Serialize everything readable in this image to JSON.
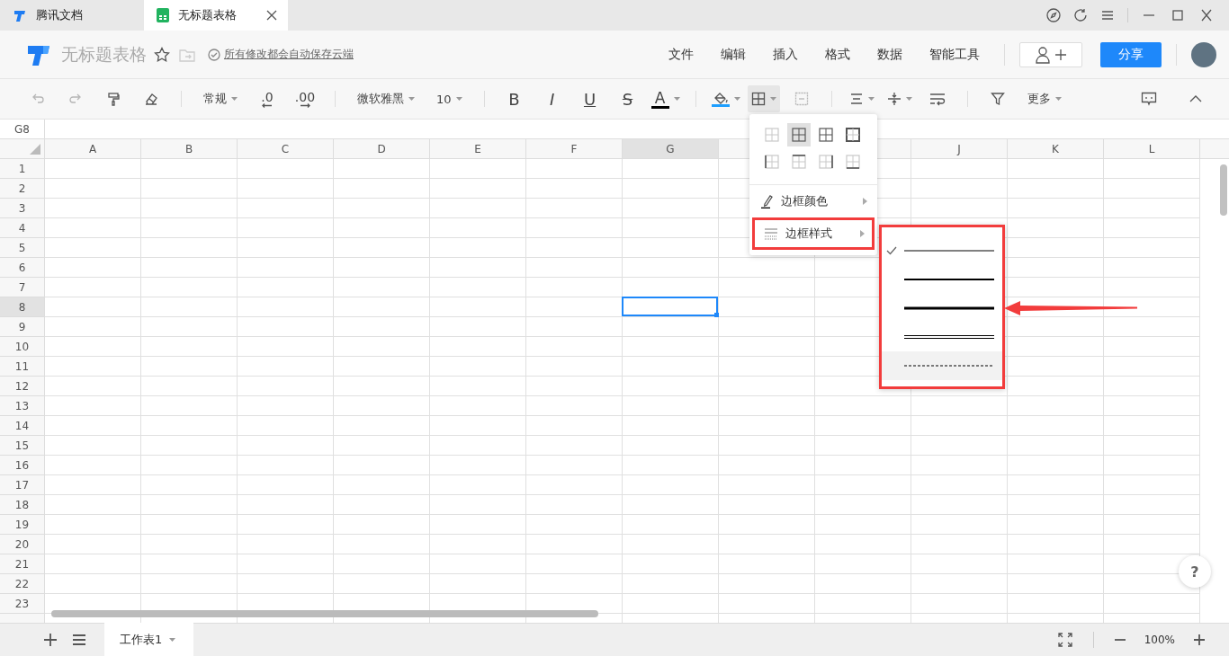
{
  "browser_tabs": [
    {
      "kind": "docs",
      "label": "腾讯文档",
      "selected": false
    },
    {
      "kind": "sheet",
      "label": "无标题表格",
      "selected": true
    }
  ],
  "header": {
    "title": "无标题表格",
    "save_status": "所有修改都会自动保存云端",
    "menu": [
      "文件",
      "编辑",
      "插入",
      "格式",
      "数据",
      "智能工具"
    ],
    "share_button": "分享"
  },
  "toolbar": {
    "groups": [
      [
        {
          "kind": "undo",
          "disabled": true,
          "open": false
        },
        {
          "kind": "redo",
          "disabled": true,
          "open": false
        },
        {
          "kind": "painter",
          "disabled": false,
          "open": false
        },
        {
          "kind": "eraser",
          "disabled": false,
          "open": false
        }
      ],
      [
        {
          "kind": "dropdown",
          "label": "常规",
          "disabled": false,
          "open": false
        },
        {
          "kind": "decimal-dec",
          "label": ".0",
          "disabled": false,
          "open": false
        },
        {
          "kind": "decimal-inc",
          "label": ".00",
          "disabled": false,
          "open": false
        }
      ],
      [
        {
          "kind": "dropdown",
          "label": "微软雅黑",
          "disabled": false,
          "open": false
        },
        {
          "kind": "dropdown",
          "label": "10",
          "disabled": false,
          "open": false
        }
      ],
      [
        {
          "kind": "bold",
          "label": "B",
          "disabled": false,
          "open": false
        },
        {
          "kind": "italic",
          "label": "I",
          "disabled": false,
          "open": false
        },
        {
          "kind": "underline",
          "label": "U",
          "disabled": false,
          "open": false
        },
        {
          "kind": "strike",
          "label": "S",
          "disabled": false,
          "open": false
        },
        {
          "kind": "font-color",
          "label": "A",
          "color": "#000000",
          "disabled": false,
          "open": false
        }
      ],
      [
        {
          "kind": "fill-color",
          "color": "#1e9fff",
          "disabled": false,
          "open": false
        },
        {
          "kind": "borders",
          "disabled": false,
          "open": true
        },
        {
          "kind": "merge",
          "disabled": true,
          "open": false
        }
      ],
      [
        {
          "kind": "align",
          "disabled": false,
          "open": false
        },
        {
          "kind": "valign",
          "disabled": false,
          "open": false
        },
        {
          "kind": "wrap",
          "disabled": false,
          "open": false
        }
      ],
      [
        {
          "kind": "filter",
          "disabled": false,
          "open": false
        },
        {
          "kind": "dropdown",
          "label": "更多",
          "disabled": false,
          "open": false
        }
      ]
    ]
  },
  "formula_bar": {
    "cell_ref": "G8"
  },
  "sheet": {
    "columns": [
      {
        "label": "A",
        "selected": false
      },
      {
        "label": "B",
        "selected": false
      },
      {
        "label": "C",
        "selected": false
      },
      {
        "label": "D",
        "selected": false
      },
      {
        "label": "E",
        "selected": false
      },
      {
        "label": "F",
        "selected": false
      },
      {
        "label": "G",
        "selected": true
      },
      {},
      {},
      {
        "label": "J",
        "selected": false
      },
      {
        "label": "K",
        "selected": false
      },
      {
        "label": "L",
        "selected": false
      }
    ],
    "rows": [
      {
        "label": "1",
        "selected": false
      },
      {
        "label": "2",
        "selected": false
      },
      {
        "label": "3",
        "selected": false
      },
      {
        "label": "4",
        "selected": false
      },
      {
        "label": "5",
        "selected": false
      },
      {
        "label": "6",
        "selected": false
      },
      {
        "label": "7",
        "selected": false
      },
      {
        "label": "8",
        "selected": true
      },
      {
        "label": "9",
        "selected": false
      },
      {
        "label": "10",
        "selected": false
      },
      {
        "label": "11",
        "selected": false
      },
      {
        "label": "12",
        "selected": false
      },
      {
        "label": "13",
        "selected": false
      },
      {
        "label": "14",
        "selected": false
      },
      {
        "label": "15",
        "selected": false
      },
      {
        "label": "16",
        "selected": false
      },
      {
        "label": "17",
        "selected": false
      },
      {
        "label": "18",
        "selected": false
      },
      {
        "label": "19",
        "selected": false
      },
      {
        "label": "20",
        "selected": false
      },
      {
        "label": "21",
        "selected": false
      },
      {
        "label": "22",
        "selected": false
      },
      {
        "label": "23",
        "selected": false
      }
    ]
  },
  "border_menu": {
    "presets": [
      {
        "kind": "none",
        "selected": false
      },
      {
        "kind": "all",
        "selected": true
      },
      {
        "kind": "inner",
        "selected": false
      },
      {
        "kind": "outer",
        "selected": false
      },
      {
        "kind": "left",
        "selected": false
      },
      {
        "kind": "top",
        "selected": false
      },
      {
        "kind": "right",
        "selected": false
      },
      {
        "kind": "bottom",
        "selected": false
      }
    ],
    "items": [
      {
        "kind": "color",
        "label": "边框颜色",
        "annotated": false
      },
      {
        "kind": "style",
        "label": "边框样式",
        "annotated": true
      }
    ]
  },
  "border_style_submenu": {
    "annotated": true,
    "styles": [
      {
        "kind": "thin",
        "checked": true,
        "hovered": false
      },
      {
        "kind": "medium",
        "checked": false,
        "hovered": false
      },
      {
        "kind": "thick",
        "checked": false,
        "hovered": false
      },
      {
        "kind": "double",
        "checked": false,
        "hovered": false
      },
      {
        "kind": "dashed",
        "checked": false,
        "hovered": true
      }
    ]
  },
  "sheet_tabs": [
    {
      "label": "工作表1",
      "selected": true
    }
  ],
  "zoom": {
    "reading": "100%"
  },
  "help_button": "?"
}
